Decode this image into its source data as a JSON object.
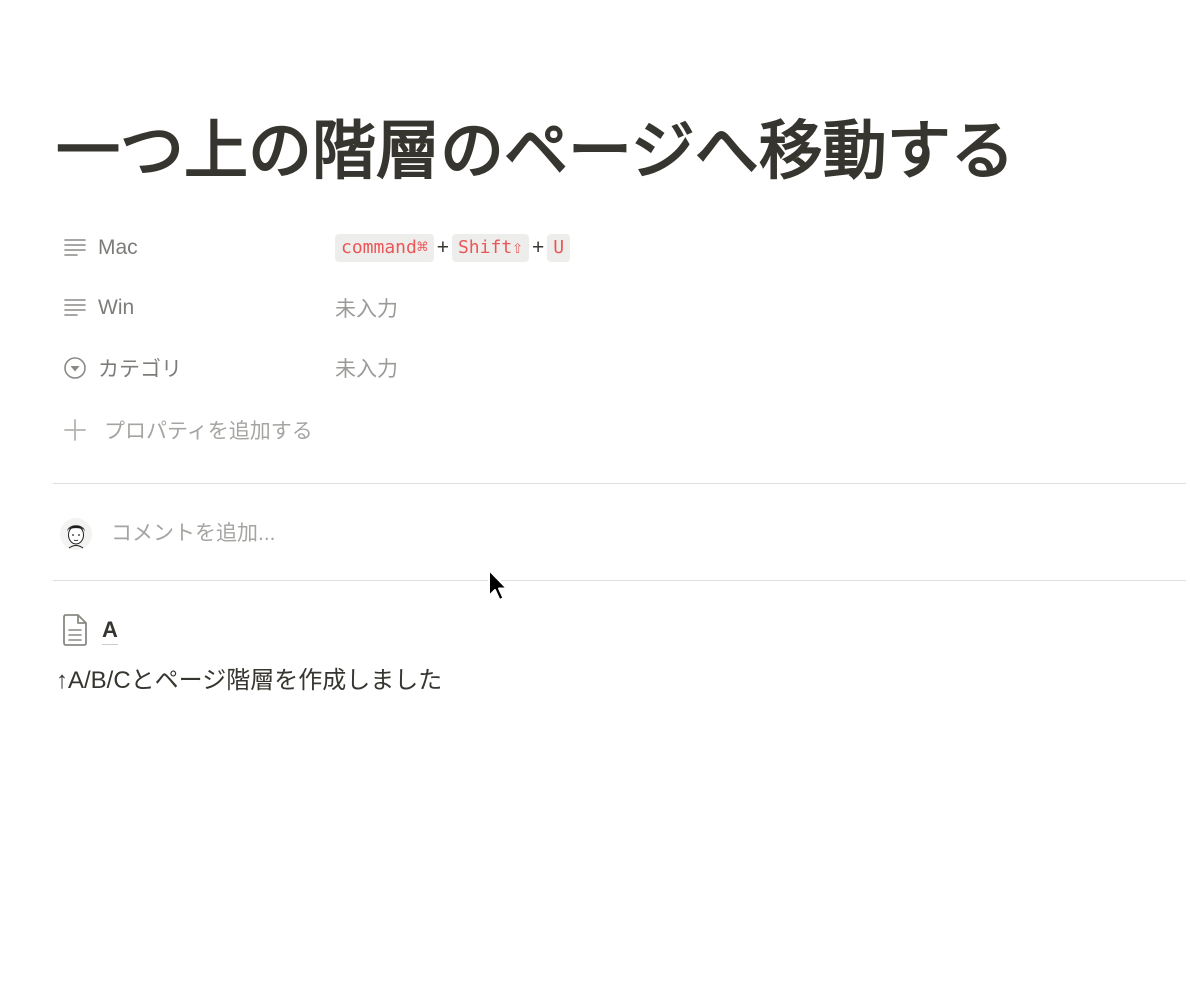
{
  "page": {
    "title": "一つ上の階層のページへ移動する"
  },
  "properties": [
    {
      "name": "Mac",
      "icon": "text-lines-icon",
      "keys": [
        "command⌘",
        "Shift⇧",
        "U"
      ],
      "separator": "+"
    },
    {
      "name": "Win",
      "icon": "text-lines-icon",
      "value": "未入力"
    },
    {
      "name": "カテゴリ",
      "icon": "select-circle-icon",
      "value": "未入力"
    }
  ],
  "add_property": {
    "label": "プロパティを追加する",
    "icon": "plus-icon"
  },
  "comment": {
    "placeholder": "コメントを追加...",
    "avatar_icon": "user-avatar-icon"
  },
  "subpage": {
    "label": "A",
    "icon": "document-icon"
  },
  "body": {
    "text": "↑A/B/Cとページ階層を作成しました"
  },
  "colors": {
    "text": "#37352f",
    "code_text": "#eb5757",
    "code_bg": "#ebeae8"
  }
}
